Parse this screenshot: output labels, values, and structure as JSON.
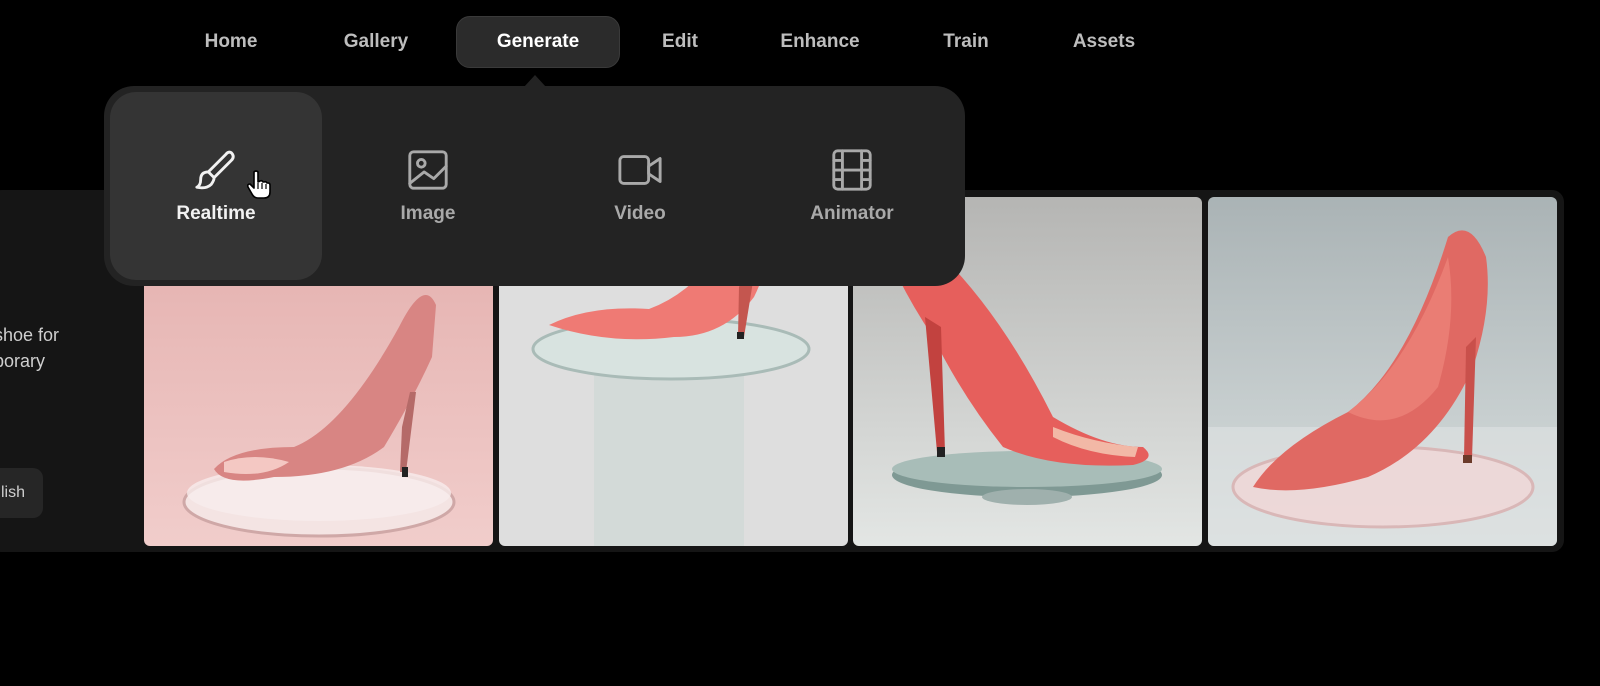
{
  "nav": {
    "items": [
      {
        "label": "Home"
      },
      {
        "label": "Gallery"
      },
      {
        "label": "Generate"
      },
      {
        "label": "Edit"
      },
      {
        "label": "Enhance"
      },
      {
        "label": "Train"
      },
      {
        "label": "Assets"
      }
    ],
    "active": "Generate"
  },
  "dropdown": {
    "options": [
      {
        "label": "Realtime",
        "icon": "brush-icon"
      },
      {
        "label": "Image",
        "icon": "image-icon"
      },
      {
        "label": "Video",
        "icon": "video-camera-icon"
      },
      {
        "label": "Animator",
        "icon": "film-icon"
      }
    ],
    "hovered": "Realtime"
  },
  "sidebar": {
    "prompt_fragment_line1": "shoe for",
    "prompt_fragment_line2": "porary",
    "publish_label": "lish"
  },
  "gallery": {
    "images": [
      {
        "background": "#e9b7b5",
        "shoe": "#d88583",
        "platform": "clear disc"
      },
      {
        "background": "#dcdcdc",
        "shoe": "#ef7a74",
        "platform": "clear pedestal"
      },
      {
        "background": "#c9ccca",
        "shoe": "#e65f5c",
        "platform": "glass plate"
      },
      {
        "background": "#b9c3c4",
        "shoe": "#e06963",
        "platform": "clear disc"
      }
    ]
  },
  "colors": {
    "background": "#000000",
    "panel": "#232323",
    "active_tab": "#2b2b2b"
  }
}
